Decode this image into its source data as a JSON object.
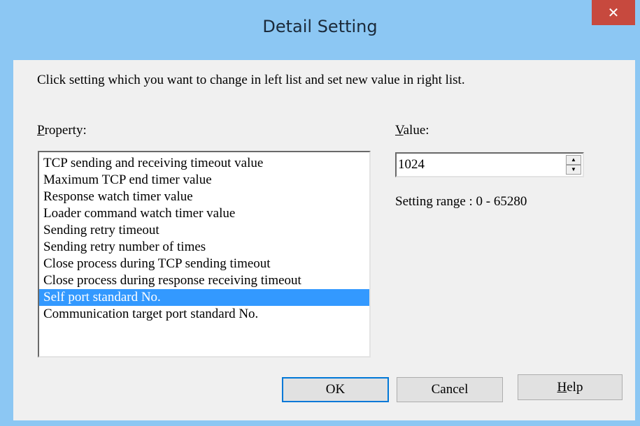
{
  "window": {
    "title": "Detail Setting",
    "close_glyph": "✕"
  },
  "instruction": "Click setting which you want to change in left list and set new value in right list.",
  "property": {
    "label_mnemonic": "P",
    "label_rest": "roperty:",
    "items": [
      "TCP sending and receiving timeout value",
      "Maximum TCP end timer value",
      "Response watch timer value",
      "Loader command watch timer value",
      "Sending retry timeout",
      "Sending retry number of times",
      "Close process during TCP sending timeout",
      "Close process during response receiving timeout",
      "Self port standard No.",
      "Communication target port standard No."
    ],
    "selected_index": 8
  },
  "value": {
    "label_mnemonic": "V",
    "label_rest": "alue:",
    "current": "1024",
    "range_text": "Setting range : 0 - 65280"
  },
  "buttons": {
    "ok": "OK",
    "cancel": "Cancel",
    "help_mnemonic": "H",
    "help_rest": "elp"
  },
  "colors": {
    "titlebar": "#8cc7f3",
    "close": "#c7493e",
    "selection": "#3399ff",
    "focus_border": "#0078d7"
  },
  "icons": {
    "close": "close-icon",
    "spin_up": "chevron-up-icon",
    "spin_down": "chevron-down-icon"
  }
}
